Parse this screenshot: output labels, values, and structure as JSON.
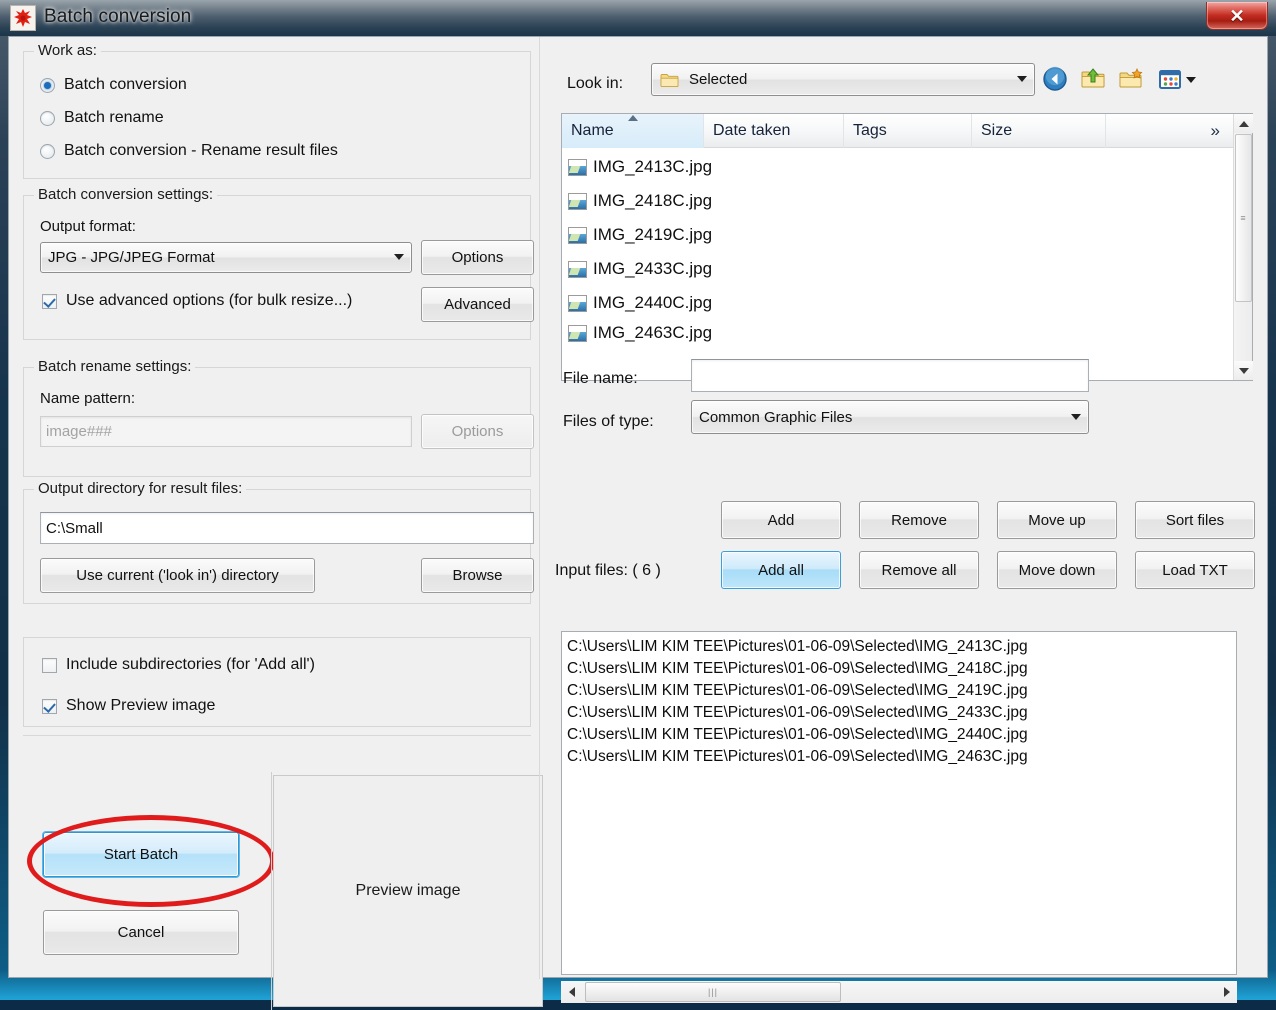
{
  "window": {
    "title": "Batch conversion",
    "icon": "app-splatter-icon",
    "close_label": "✕"
  },
  "left": {
    "work_as": {
      "title": "Work as:",
      "options": [
        {
          "label": "Batch conversion",
          "checked": true
        },
        {
          "label": "Batch rename",
          "checked": false
        },
        {
          "label": "Batch conversion - Rename result files",
          "checked": false
        }
      ]
    },
    "conversion_settings": {
      "title": "Batch conversion settings:",
      "output_format_label": "Output format:",
      "output_format_value": "JPG - JPG/JPEG Format",
      "options_button": "Options",
      "advanced_checkbox_label": "Use advanced options (for bulk resize...)",
      "advanced_checkbox_checked": true,
      "advanced_button": "Advanced"
    },
    "rename_settings": {
      "title": "Batch rename settings:",
      "name_pattern_label": "Name pattern:",
      "name_pattern_value": "",
      "name_pattern_placeholder": "image###",
      "options_button": "Options"
    },
    "output_dir": {
      "title": "Output directory for result files:",
      "value": "C:\\Small",
      "use_current_button": "Use current ('look in') directory",
      "browse_button": "Browse"
    },
    "misc": {
      "include_subdirs_label": "Include subdirectories (for 'Add all')",
      "include_subdirs_checked": false,
      "show_preview_label": "Show Preview image",
      "show_preview_checked": true
    },
    "actions": {
      "start_button": "Start Batch",
      "cancel_button": "Cancel",
      "preview_placeholder": "Preview image"
    }
  },
  "right": {
    "look_in": {
      "label": "Look in:",
      "value": "Selected",
      "toolbar": [
        {
          "name": "back-icon"
        },
        {
          "name": "up-folder-icon"
        },
        {
          "name": "new-folder-icon"
        },
        {
          "name": "views-icon"
        }
      ]
    },
    "file_browser": {
      "columns": [
        "Name",
        "Date taken",
        "Tags",
        "Size"
      ],
      "more_columns_glyph": "»",
      "sorted_column": "Name",
      "rows": [
        "IMG_2413C.jpg",
        "IMG_2418C.jpg",
        "IMG_2419C.jpg",
        "IMG_2433C.jpg",
        "IMG_2440C.jpg",
        "IMG_2463C.jpg"
      ]
    },
    "file_name": {
      "label": "File name:",
      "value": ""
    },
    "files_of_type": {
      "label": "Files of type:",
      "value": "Common Graphic Files"
    },
    "list_buttons": [
      "Add",
      "Remove",
      "Move up",
      "Sort files",
      "Add all",
      "Remove all",
      "Move down",
      "Load TXT"
    ],
    "input_files": {
      "label": "Input files: ( 6 )",
      "count": 6,
      "paths": [
        "C:\\Users\\LIM KIM TEE\\Pictures\\01-06-09\\Selected\\IMG_2413C.jpg",
        "C:\\Users\\LIM KIM TEE\\Pictures\\01-06-09\\Selected\\IMG_2418C.jpg",
        "C:\\Users\\LIM KIM TEE\\Pictures\\01-06-09\\Selected\\IMG_2419C.jpg",
        "C:\\Users\\LIM KIM TEE\\Pictures\\01-06-09\\Selected\\IMG_2433C.jpg",
        "C:\\Users\\LIM KIM TEE\\Pictures\\01-06-09\\Selected\\IMG_2440C.jpg",
        "C:\\Users\\LIM KIM TEE\\Pictures\\01-06-09\\Selected\\IMG_2463C.jpg"
      ]
    }
  },
  "annotation": {
    "highlight_color": "#e01b1b",
    "target": "Start Batch"
  }
}
